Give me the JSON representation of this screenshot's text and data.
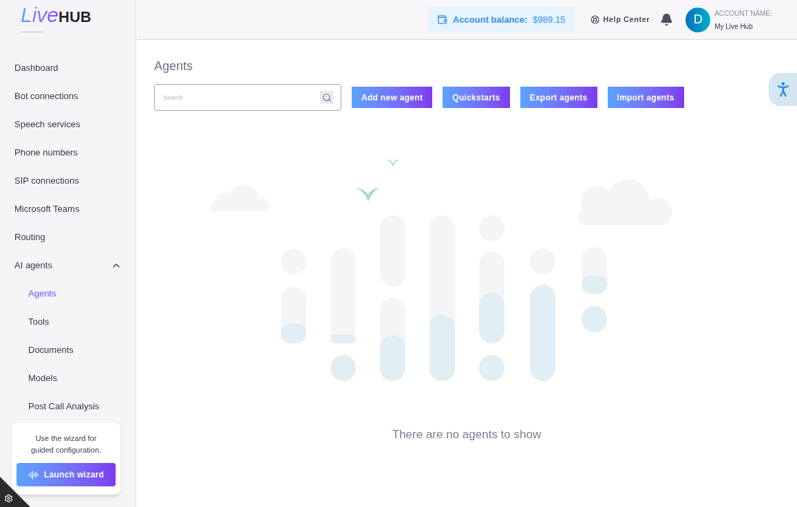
{
  "logo": {
    "part_1": "Live",
    "part_2": "HUB"
  },
  "header": {
    "balance_label": "Account balance:",
    "balance_value": "$989.15",
    "help": "Help Center",
    "avatar": "D",
    "account_label": "ACCOUNT NAME:",
    "account_name": "My Live Hub"
  },
  "sidebar": {
    "items": [
      {
        "label": "Dashboard",
        "selected": false
      },
      {
        "label": "Bot connections",
        "selected": false
      },
      {
        "label": "Speech services",
        "selected": false
      },
      {
        "label": "Phone numbers",
        "selected": false
      },
      {
        "label": "SIP connections",
        "selected": false
      },
      {
        "label": "Microsoft Teams",
        "selected": false
      },
      {
        "label": "Routing",
        "selected": false
      },
      {
        "label": "AI agents",
        "selected": false,
        "expanded": true,
        "children": [
          {
            "label": "Agents",
            "selected": true
          },
          {
            "label": "Tools",
            "selected": false
          },
          {
            "label": "Documents",
            "selected": false
          },
          {
            "label": "Models",
            "selected": false
          },
          {
            "label": "Post Call Analysis",
            "selected": false
          }
        ]
      }
    ]
  },
  "wizard": {
    "text": "Use the wizard for guided configuration.",
    "button": "Launch wizard"
  },
  "page": {
    "title": "Agents",
    "search": {
      "placeholder": "Search"
    },
    "buttons": [
      "Add new agent",
      "Quickstarts",
      "Export agents",
      "Import agents"
    ],
    "empty_message": "There are no agents to show"
  }
}
